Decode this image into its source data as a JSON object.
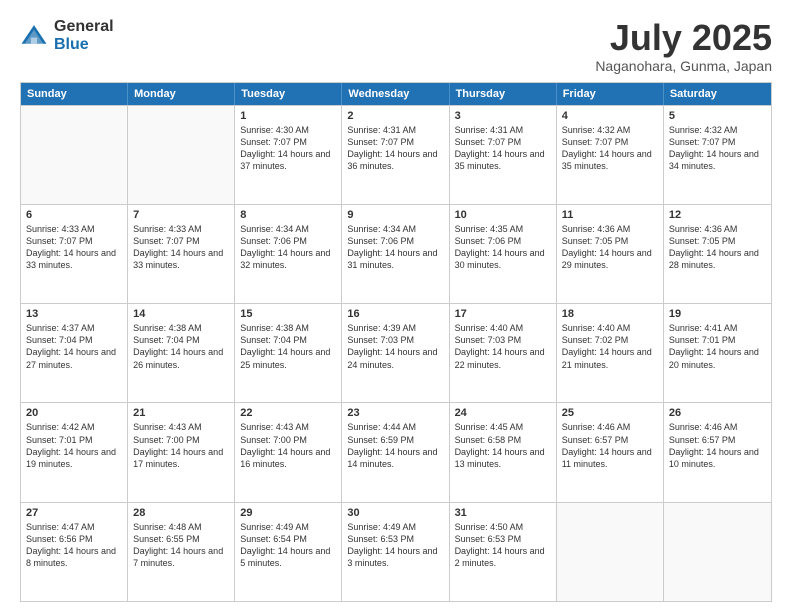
{
  "logo": {
    "general": "General",
    "blue": "Blue"
  },
  "title": "July 2025",
  "location": "Naganohara, Gunma, Japan",
  "header_days": [
    "Sunday",
    "Monday",
    "Tuesday",
    "Wednesday",
    "Thursday",
    "Friday",
    "Saturday"
  ],
  "weeks": [
    [
      {
        "day": "",
        "info": ""
      },
      {
        "day": "",
        "info": ""
      },
      {
        "day": "1",
        "info": "Sunrise: 4:30 AM\nSunset: 7:07 PM\nDaylight: 14 hours and 37 minutes."
      },
      {
        "day": "2",
        "info": "Sunrise: 4:31 AM\nSunset: 7:07 PM\nDaylight: 14 hours and 36 minutes."
      },
      {
        "day": "3",
        "info": "Sunrise: 4:31 AM\nSunset: 7:07 PM\nDaylight: 14 hours and 35 minutes."
      },
      {
        "day": "4",
        "info": "Sunrise: 4:32 AM\nSunset: 7:07 PM\nDaylight: 14 hours and 35 minutes."
      },
      {
        "day": "5",
        "info": "Sunrise: 4:32 AM\nSunset: 7:07 PM\nDaylight: 14 hours and 34 minutes."
      }
    ],
    [
      {
        "day": "6",
        "info": "Sunrise: 4:33 AM\nSunset: 7:07 PM\nDaylight: 14 hours and 33 minutes."
      },
      {
        "day": "7",
        "info": "Sunrise: 4:33 AM\nSunset: 7:07 PM\nDaylight: 14 hours and 33 minutes."
      },
      {
        "day": "8",
        "info": "Sunrise: 4:34 AM\nSunset: 7:06 PM\nDaylight: 14 hours and 32 minutes."
      },
      {
        "day": "9",
        "info": "Sunrise: 4:34 AM\nSunset: 7:06 PM\nDaylight: 14 hours and 31 minutes."
      },
      {
        "day": "10",
        "info": "Sunrise: 4:35 AM\nSunset: 7:06 PM\nDaylight: 14 hours and 30 minutes."
      },
      {
        "day": "11",
        "info": "Sunrise: 4:36 AM\nSunset: 7:05 PM\nDaylight: 14 hours and 29 minutes."
      },
      {
        "day": "12",
        "info": "Sunrise: 4:36 AM\nSunset: 7:05 PM\nDaylight: 14 hours and 28 minutes."
      }
    ],
    [
      {
        "day": "13",
        "info": "Sunrise: 4:37 AM\nSunset: 7:04 PM\nDaylight: 14 hours and 27 minutes."
      },
      {
        "day": "14",
        "info": "Sunrise: 4:38 AM\nSunset: 7:04 PM\nDaylight: 14 hours and 26 minutes."
      },
      {
        "day": "15",
        "info": "Sunrise: 4:38 AM\nSunset: 7:04 PM\nDaylight: 14 hours and 25 minutes."
      },
      {
        "day": "16",
        "info": "Sunrise: 4:39 AM\nSunset: 7:03 PM\nDaylight: 14 hours and 24 minutes."
      },
      {
        "day": "17",
        "info": "Sunrise: 4:40 AM\nSunset: 7:03 PM\nDaylight: 14 hours and 22 minutes."
      },
      {
        "day": "18",
        "info": "Sunrise: 4:40 AM\nSunset: 7:02 PM\nDaylight: 14 hours and 21 minutes."
      },
      {
        "day": "19",
        "info": "Sunrise: 4:41 AM\nSunset: 7:01 PM\nDaylight: 14 hours and 20 minutes."
      }
    ],
    [
      {
        "day": "20",
        "info": "Sunrise: 4:42 AM\nSunset: 7:01 PM\nDaylight: 14 hours and 19 minutes."
      },
      {
        "day": "21",
        "info": "Sunrise: 4:43 AM\nSunset: 7:00 PM\nDaylight: 14 hours and 17 minutes."
      },
      {
        "day": "22",
        "info": "Sunrise: 4:43 AM\nSunset: 7:00 PM\nDaylight: 14 hours and 16 minutes."
      },
      {
        "day": "23",
        "info": "Sunrise: 4:44 AM\nSunset: 6:59 PM\nDaylight: 14 hours and 14 minutes."
      },
      {
        "day": "24",
        "info": "Sunrise: 4:45 AM\nSunset: 6:58 PM\nDaylight: 14 hours and 13 minutes."
      },
      {
        "day": "25",
        "info": "Sunrise: 4:46 AM\nSunset: 6:57 PM\nDaylight: 14 hours and 11 minutes."
      },
      {
        "day": "26",
        "info": "Sunrise: 4:46 AM\nSunset: 6:57 PM\nDaylight: 14 hours and 10 minutes."
      }
    ],
    [
      {
        "day": "27",
        "info": "Sunrise: 4:47 AM\nSunset: 6:56 PM\nDaylight: 14 hours and 8 minutes."
      },
      {
        "day": "28",
        "info": "Sunrise: 4:48 AM\nSunset: 6:55 PM\nDaylight: 14 hours and 7 minutes."
      },
      {
        "day": "29",
        "info": "Sunrise: 4:49 AM\nSunset: 6:54 PM\nDaylight: 14 hours and 5 minutes."
      },
      {
        "day": "30",
        "info": "Sunrise: 4:49 AM\nSunset: 6:53 PM\nDaylight: 14 hours and 3 minutes."
      },
      {
        "day": "31",
        "info": "Sunrise: 4:50 AM\nSunset: 6:53 PM\nDaylight: 14 hours and 2 minutes."
      },
      {
        "day": "",
        "info": ""
      },
      {
        "day": "",
        "info": ""
      }
    ]
  ]
}
